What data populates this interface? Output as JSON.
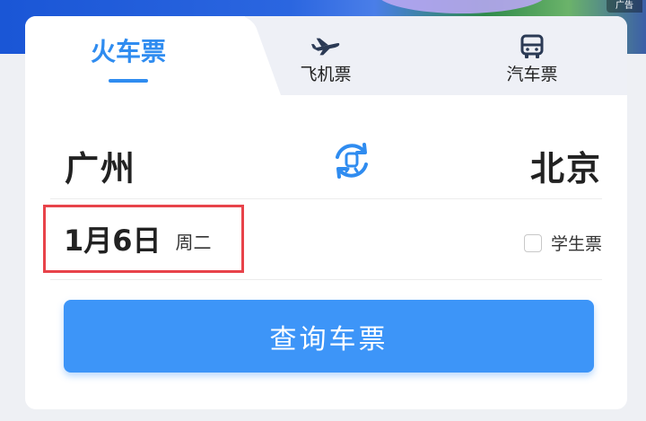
{
  "banner": {
    "ad_label": "广告"
  },
  "tabs": [
    {
      "label": "火车票",
      "icon": "train-tab",
      "active": true
    },
    {
      "label": "飞机票",
      "icon": "airplane-icon",
      "active": false
    },
    {
      "label": "汽车票",
      "icon": "bus-icon",
      "active": false
    }
  ],
  "route": {
    "from": "广州",
    "to": "北京",
    "swap_icon": "swap-icon"
  },
  "date": {
    "value": "1月6日",
    "weekday": "周二"
  },
  "options": {
    "student_ticket_label": "学生票",
    "student_ticket_checked": false
  },
  "search": {
    "button_label": "查询车票"
  },
  "colors": {
    "accent": "#2f8cf0",
    "button": "#3d95f8",
    "highlight_box": "#e8434a"
  }
}
